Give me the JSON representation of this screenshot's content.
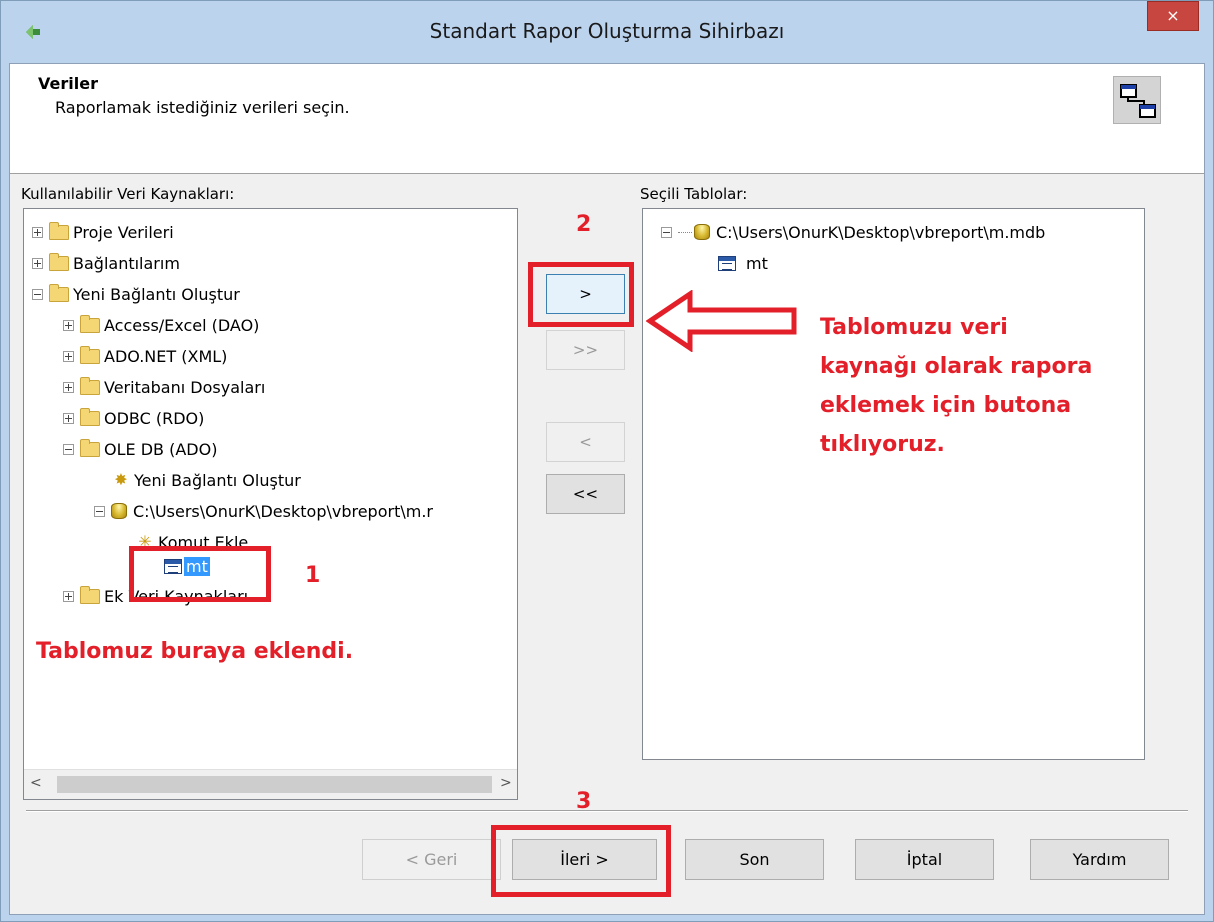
{
  "window": {
    "title": "Standart Rapor Oluşturma Sihirbazı",
    "close_label": "×"
  },
  "header": {
    "title": "Veriler",
    "subtitle": "Raporlamak istediğiniz verileri seçin."
  },
  "left_panel": {
    "label": "Kullanılabilir Veri Kaynakları:",
    "items": [
      {
        "label": "Proje Verileri"
      },
      {
        "label": "Bağlantılarım"
      },
      {
        "label": "Yeni Bağlantı Oluştur"
      },
      {
        "label": "Access/Excel (DAO)"
      },
      {
        "label": "ADO.NET (XML)"
      },
      {
        "label": "Veritabanı Dosyaları"
      },
      {
        "label": "ODBC (RDO)"
      },
      {
        "label": "OLE DB (ADO)"
      },
      {
        "label": "Yeni Bağlantı Oluştur"
      },
      {
        "label": "C:\\Users\\OnurK\\Desktop\\vbreport\\m.r"
      },
      {
        "label": "Komut Ekle"
      },
      {
        "label": "mt"
      },
      {
        "label": "Ek Veri Kaynakları"
      }
    ]
  },
  "right_panel": {
    "label": "Seçili Tablolar:",
    "items": [
      {
        "label": "C:\\Users\\OnurK\\Desktop\\vbreport\\m.mdb"
      },
      {
        "label": "mt"
      }
    ]
  },
  "middle_buttons": {
    "add": ">",
    "add_all": ">>",
    "remove": "<",
    "remove_all": "<<"
  },
  "bottom_buttons": {
    "back": "< Geri",
    "next": "İleri >",
    "finish": "Son",
    "cancel": "İptal",
    "help": "Yardım"
  },
  "annotations": {
    "step1": "1",
    "step2": "2",
    "step3": "3",
    "note_left": "Tablomuz buraya eklendi.",
    "note_right_lines": [
      "Tablomuzu veri",
      "kaynağı olarak rapora",
      "eklemek için butona",
      "tıklıyoruz."
    ],
    "accent_color": "#e3202a"
  },
  "scrollbar": {
    "left_arrow": "<",
    "right_arrow": ">"
  }
}
